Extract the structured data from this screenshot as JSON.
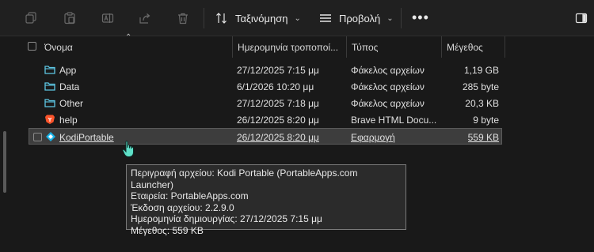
{
  "toolbar": {
    "sort_label": "Ταξινόμηση",
    "view_label": "Προβολή",
    "more_label": "•••",
    "icons": [
      "copy-icon",
      "paste-icon",
      "rename-icon",
      "share-icon",
      "delete-icon",
      "sort-icon",
      "view-icon",
      "details-pane-icon"
    ]
  },
  "columns": {
    "name": "Όνομα",
    "date": "Ημερομηνία τροποποί...",
    "type": "Τύπος",
    "size": "Μέγεθος"
  },
  "files": [
    {
      "name": "App",
      "date": "27/12/2025 7:15 μμ",
      "type": "Φάκελος αρχείων",
      "size": "1,19 GB",
      "icon": "folder-icon"
    },
    {
      "name": "Data",
      "date": "6/1/2026 10:20 μμ",
      "type": "Φάκελος αρχείων",
      "size": "285 byte",
      "icon": "folder-icon"
    },
    {
      "name": "Other",
      "date": "27/12/2025 7:18 μμ",
      "type": "Φάκελος αρχείων",
      "size": "20,3 KB",
      "icon": "folder-icon"
    },
    {
      "name": "help",
      "date": "26/12/2025 8:20 μμ",
      "type": "Brave HTML Docu...",
      "size": "9 byte",
      "icon": "brave-icon"
    },
    {
      "name": "KodiPortable",
      "date": "26/12/2025 8:20 μμ",
      "type": "Εφαρμογή",
      "size": "559 KB",
      "icon": "kodi-icon"
    }
  ],
  "tooltip": {
    "lines": [
      "Περιγραφή αρχείου: Kodi Portable (PortableApps.com Launcher)",
      "Εταιρεία: PortableApps.com",
      "Έκδοση αρχείου: 2.2.9.0",
      "Ημερομηνία δημιουργίας: 27/12/2025 7:15 μμ",
      "Μέγεθος: 559 KB"
    ]
  },
  "colors": {
    "background": "#191919",
    "folder": "#5ec8e5",
    "brave": "#fb542b",
    "kodi": "#17b2e7",
    "selected_row": "#3d3d3d"
  }
}
